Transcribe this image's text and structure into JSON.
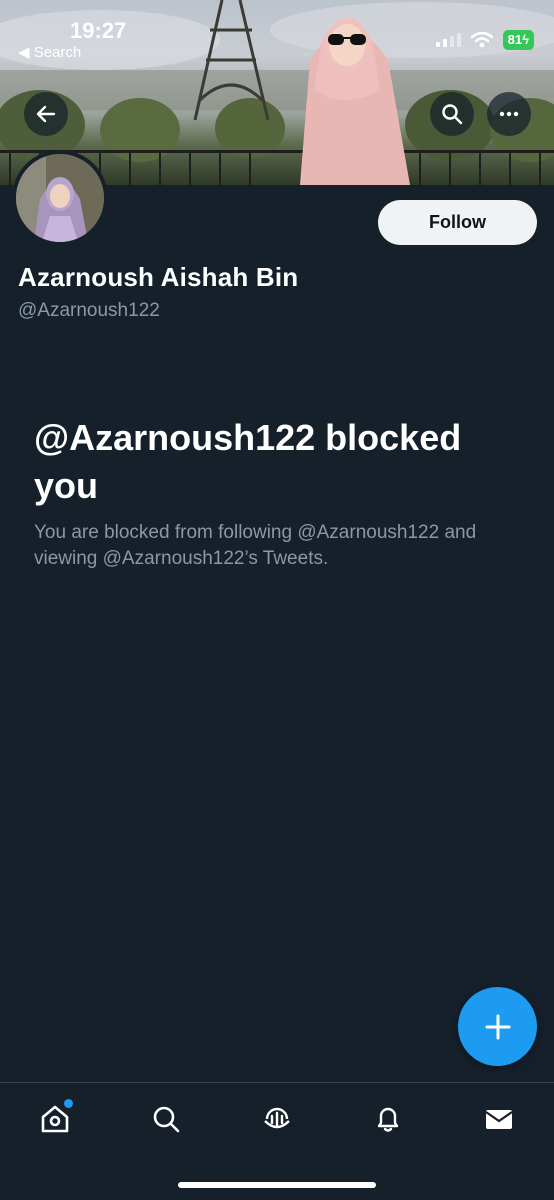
{
  "status_bar": {
    "time": "19:27",
    "back_label": "◀ Search",
    "battery": "81"
  },
  "header": {
    "back_icon": "arrow-left-icon",
    "search_icon": "search-icon",
    "more_icon": "more-horizontal-icon"
  },
  "profile": {
    "display_name": "Azarnoush Aishah Bin",
    "handle": "@Azarnoush122",
    "follow_label": "Follow"
  },
  "blocked": {
    "title": "@Azarnoush122 blocked you",
    "description": "You are blocked from following @Azarnoush122 and viewing @Azarnoush122’s Tweets."
  },
  "bottom_nav": {
    "items": [
      "home-icon",
      "search-icon",
      "spaces-icon",
      "notifications-icon",
      "messages-icon"
    ]
  },
  "colors": {
    "background": "#15202b",
    "accent": "#1d9bf0",
    "secondary_text": "#8b98a5",
    "battery": "#34c759"
  }
}
